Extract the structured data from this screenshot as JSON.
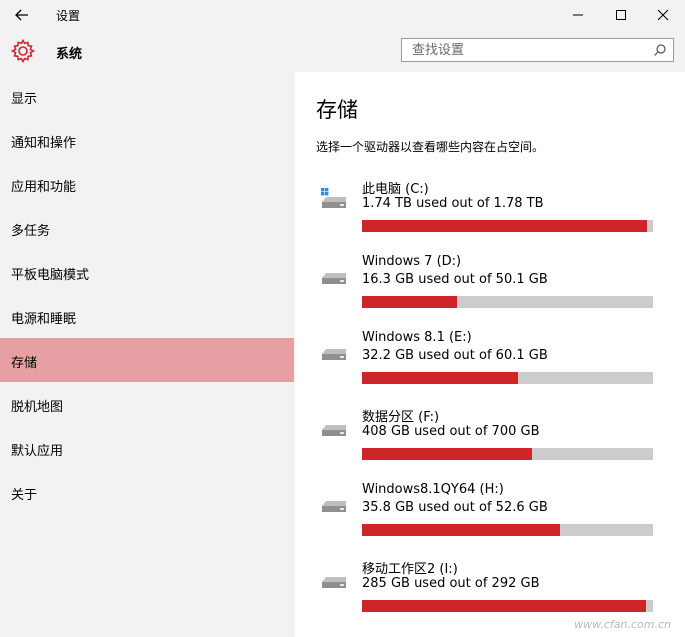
{
  "titlebar": {
    "title": "设置"
  },
  "header": {
    "title": "系统",
    "search_placeholder": "查找设置"
  },
  "sidebar": {
    "items": [
      {
        "label": "显示"
      },
      {
        "label": "通知和操作"
      },
      {
        "label": "应用和功能"
      },
      {
        "label": "多任务"
      },
      {
        "label": "平板电脑模式"
      },
      {
        "label": "电源和睡眠"
      },
      {
        "label": "存储",
        "active": true
      },
      {
        "label": "脱机地图"
      },
      {
        "label": "默认应用"
      },
      {
        "label": "关于"
      }
    ]
  },
  "main": {
    "title": "存储",
    "description": "选择一个驱动器以查看哪些内容在占空间。",
    "drives": [
      {
        "name": "此电脑 (C:)",
        "usage": "1.74 TB used out of 1.78 TB",
        "fraction": 0.978,
        "icon": "system-drive-icon"
      },
      {
        "name": "Windows 7 (D:)",
        "usage": "16.3 GB used out of 50.1 GB",
        "fraction": 0.325,
        "icon": "drive-icon"
      },
      {
        "name": "Windows 8.1 (E:)",
        "usage": "32.2 GB used out of 60.1 GB",
        "fraction": 0.536,
        "icon": "drive-icon"
      },
      {
        "name": "数据分区 (F:)",
        "usage": "408 GB used out of 700 GB",
        "fraction": 0.583,
        "icon": "drive-icon"
      },
      {
        "name": "Windows8.1QY64 (H:)",
        "usage": "35.8 GB used out of 52.6 GB",
        "fraction": 0.681,
        "icon": "drive-icon"
      },
      {
        "name": "移动工作区2 (I:)",
        "usage": "285 GB used out of 292 GB",
        "fraction": 0.976,
        "icon": "drive-icon"
      }
    ]
  },
  "colors": {
    "accent": "#d0242b",
    "active_nav": "#e6a0a4",
    "bar_bg": "#cccccc",
    "panel_bg": "#f2f2f2"
  },
  "watermark": "www.cfan.com.cn"
}
